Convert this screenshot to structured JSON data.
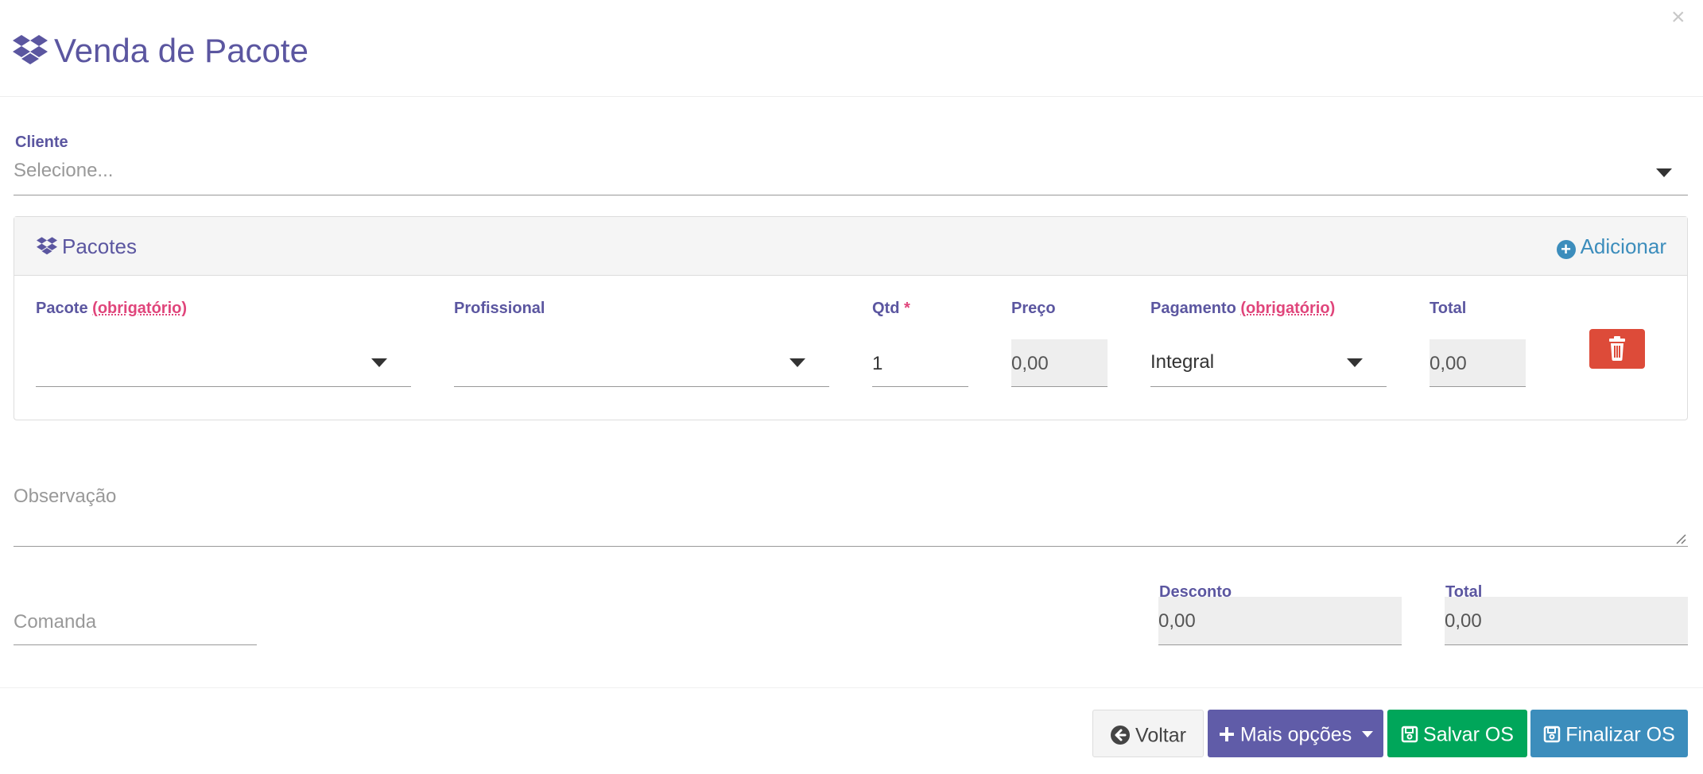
{
  "header": {
    "title": "Venda de Pacote",
    "close_label": "×"
  },
  "cliente": {
    "label": "Cliente",
    "placeholder": "Selecione..."
  },
  "pacotes_panel": {
    "title": "Pacotes",
    "add_label": "Adicionar",
    "columns": {
      "pacote": {
        "label": "Pacote",
        "required_note": "(obrigatório)"
      },
      "profissional": {
        "label": "Profissional"
      },
      "qtd": {
        "label": "Qtd",
        "required_mark": "*"
      },
      "preco": {
        "label": "Preço"
      },
      "pagamento": {
        "label": "Pagamento",
        "required_note": "(obrigatório)"
      },
      "total": {
        "label": "Total"
      }
    },
    "row": {
      "pacote": "",
      "profissional": "",
      "qtd": "1",
      "preco": "0,00",
      "pagamento": "Integral",
      "total": "0,00"
    }
  },
  "observacao": {
    "placeholder": "Observação"
  },
  "comanda": {
    "placeholder": "Comanda"
  },
  "desconto": {
    "label": "Desconto",
    "value": "0,00"
  },
  "total_geral": {
    "label": "Total",
    "value": "0,00"
  },
  "footer": {
    "voltar": "Voltar",
    "mais_opcoes": "Mais opções",
    "salvar": "Salvar OS",
    "finalizar": "Finalizar OS"
  },
  "colors": {
    "primary_text": "#5b56a0",
    "required": "#e0457b",
    "danger": "#dd4b39",
    "purple_button": "#605ca8",
    "green_button": "#00a65a",
    "blue_button": "#3c8dbc"
  },
  "icons": {
    "title": "dropbox-icon",
    "panel": "dropbox-icon",
    "add": "plus-circle-icon",
    "delete": "trash-icon",
    "back": "arrow-circle-left-icon",
    "more": "plus-icon",
    "save": "floppy-disk-icon"
  }
}
